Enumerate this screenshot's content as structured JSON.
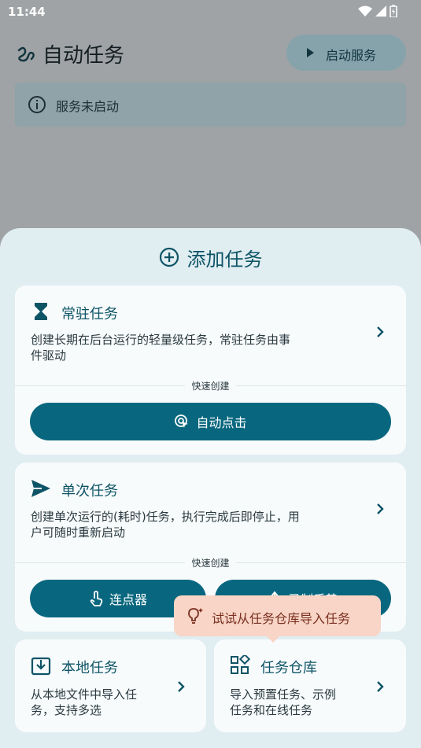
{
  "status": {
    "time": "11:44"
  },
  "app": {
    "title": "自动任务",
    "start_button": "启动服务",
    "banner": "服务未启动"
  },
  "sheet": {
    "title": "添加任务",
    "resident": {
      "title": "常驻任务",
      "desc_line1": "创建长期在后台运行的轻量级任务，常驻任务由事",
      "desc_line2": "件驱动",
      "quick_label": "快速创建",
      "quick_button": "自动点击"
    },
    "single": {
      "title": "单次任务",
      "desc_line1": "创建单次运行的(耗时)任务，执行完成后即停止，用",
      "desc_line2": "户可随时重新启动",
      "quick_label": "快速创建",
      "button_clicker": "连点器",
      "button_record": "录制手势"
    },
    "local": {
      "title": "本地任务",
      "desc_line1": "从本地文件中导入任",
      "desc_line2": "务，支持多选"
    },
    "repo": {
      "title": "任务仓库",
      "desc_line1": "导入预置任务、示例",
      "desc_line2": "任务和在线任务"
    },
    "tooltip": "试试从任务仓库导入任务"
  },
  "colors": {
    "accent": "#08677e",
    "title_teal": "#0d5466",
    "sheet_bg": "#e0edf1",
    "card_bg": "#f8fbfc",
    "tooltip_bg": "#f8d5c6",
    "scrim": "#9fa3a5"
  }
}
